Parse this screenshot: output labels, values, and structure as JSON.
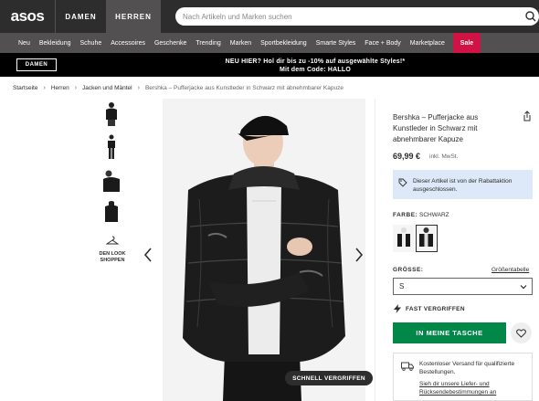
{
  "header": {
    "logo": "asos",
    "tabs": [
      {
        "label": "DAMEN"
      },
      {
        "label": "HERREN"
      }
    ],
    "search_placeholder": "Nach Artikeln und Marken suchen"
  },
  "nav": {
    "items": [
      "Neu",
      "Bekleidung",
      "Schuhe",
      "Accessoires",
      "Geschenke",
      "Trending",
      "Marken",
      "Sportbekleidung",
      "Smarte Styles",
      "Face + Body",
      "Marketplace"
    ],
    "sale": "Sale"
  },
  "promo": {
    "button": "DAMEN",
    "line1": "NEU HIER? Hol dir bis zu -10% auf ausgewählte Styles!*",
    "line2": "Mit dem Code: HALLO"
  },
  "breadcrumb": [
    "Startseite",
    "Herren",
    "Jacken und Mäntel",
    "Bershka – Pufferjacke aus Kunstleder in Schwarz mit abnehmbarer Kapuze"
  ],
  "gallery": {
    "look_label": "DEN LOOK SHOPPEN",
    "quick_view": "SCHNELL VERGRIFFEN"
  },
  "product": {
    "title": "Bershka – Pufferjacke aus Kunstleder in Schwarz mit abnehmbarer Kapuze",
    "price": "69,99 €",
    "vat": "inkl. MwSt.",
    "info": "Dieser Artikel ist von der Rabattaktion ausgeschlossen.",
    "color_key": "FARBE:",
    "color_value": "SCHWARZ",
    "size_key": "GRÖSSE:",
    "size_guide": "Größentabelle",
    "size_selected": "S",
    "fast_label": "FAST VERGRIFFEN",
    "add_to_bag": "IN MEINE TASCHE",
    "shipping_text": "Kostenloser Versand für qualifizierte Bestellungen.",
    "shipping_link": "Sieh dir unsere Liefer- und Rücksendebestimmungen an"
  },
  "colors": {
    "accent": "#018849",
    "sale": "#d01345",
    "header": "#2d2d2d",
    "nav": "#525050",
    "info_bg": "#dde8f8"
  }
}
